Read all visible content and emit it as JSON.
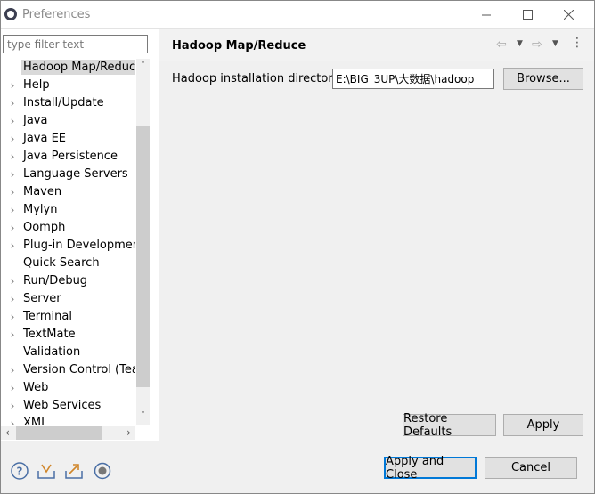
{
  "window": {
    "title": "Preferences",
    "minimize_icon": "minimize-icon",
    "maximize_icon": "maximize-icon",
    "close_icon": "close-icon"
  },
  "sidebar": {
    "filter_placeholder": "type filter text",
    "items": [
      {
        "label": "Hadoop Map/Reduce",
        "has_children": false,
        "selected": true
      },
      {
        "label": "Help",
        "has_children": true
      },
      {
        "label": "Install/Update",
        "has_children": true
      },
      {
        "label": "Java",
        "has_children": true
      },
      {
        "label": "Java EE",
        "has_children": true
      },
      {
        "label": "Java Persistence",
        "has_children": true
      },
      {
        "label": "Language Servers",
        "has_children": true
      },
      {
        "label": "Maven",
        "has_children": true
      },
      {
        "label": "Mylyn",
        "has_children": true
      },
      {
        "label": "Oomph",
        "has_children": true
      },
      {
        "label": "Plug-in Development",
        "has_children": true
      },
      {
        "label": "Quick Search",
        "has_children": false
      },
      {
        "label": "Run/Debug",
        "has_children": true
      },
      {
        "label": "Server",
        "has_children": true
      },
      {
        "label": "Terminal",
        "has_children": true
      },
      {
        "label": "TextMate",
        "has_children": true
      },
      {
        "label": "Validation",
        "has_children": false
      },
      {
        "label": "Version Control (Team)",
        "has_children": true
      },
      {
        "label": "Web",
        "has_children": true
      },
      {
        "label": "Web Services",
        "has_children": true
      },
      {
        "label": "XML",
        "has_children": true
      }
    ]
  },
  "page": {
    "title": "Hadoop Map/Reduce",
    "install_dir_label": "Hadoop installation directory:",
    "install_dir_value": "E:\\BIG_3UP\\大数据\\hadoop",
    "browse_label": "Browse...",
    "restore_defaults_label": "Restore Defaults",
    "apply_label": "Apply"
  },
  "footer": {
    "apply_close_label": "Apply and Close",
    "cancel_label": "Cancel"
  }
}
